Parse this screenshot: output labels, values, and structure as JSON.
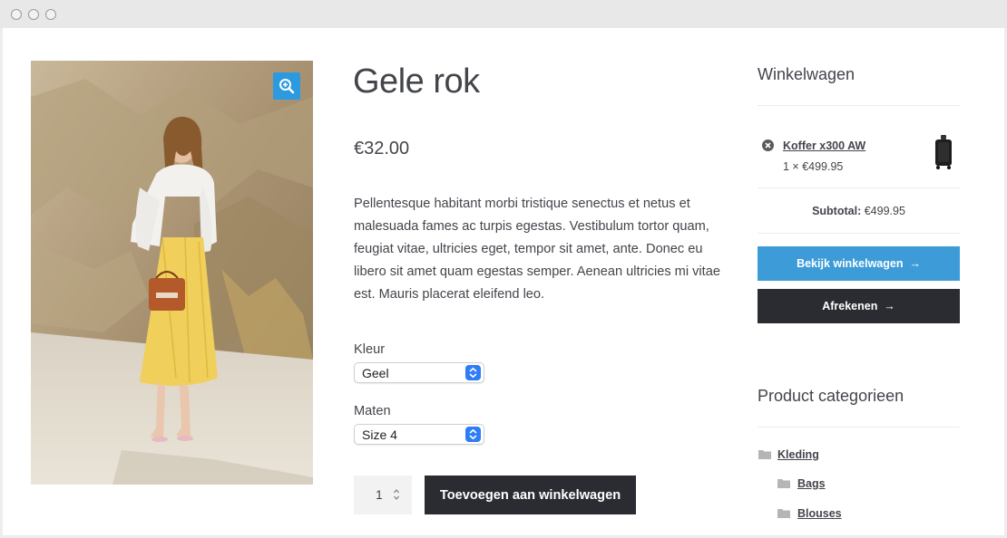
{
  "product": {
    "title": "Gele rok",
    "price": "€32.00",
    "description": "Pellentesque habitant morbi tristique senectus et netus et malesuada fames ac turpis egestas. Vestibulum tortor quam, feugiat vitae, ultricies eget, tempor sit amet, ante. Donec eu libero sit amet quam egestas semper. Aenean ultricies mi vitae est. Mauris placerat eleifend leo.",
    "variations": [
      {
        "label": "Kleur",
        "selected": "Geel"
      },
      {
        "label": "Maten",
        "selected": "Size 4"
      }
    ],
    "quantity": "1",
    "add_to_cart_label": "Toevoegen aan winkelwagen",
    "zoom_icon": "zoom-in-icon"
  },
  "cart_widget": {
    "title": "Winkelwagen",
    "item": {
      "name": "Koffer x300 AW",
      "qty_price": "1 × €499.95"
    },
    "subtotal_label": "Subtotal:",
    "subtotal_value": "€499.95",
    "view_cart_label": "Bekijk winkelwagen",
    "checkout_label": "Afrekenen",
    "arrow": "→"
  },
  "categories_widget": {
    "title": "Product categorieen",
    "items": [
      {
        "label": "Kleding"
      },
      {
        "label": "Bags"
      },
      {
        "label": "Blouses"
      }
    ]
  },
  "colors": {
    "accent_blue": "#3d9cd8",
    "dark_button": "#2b2c32",
    "text": "#43454b"
  }
}
